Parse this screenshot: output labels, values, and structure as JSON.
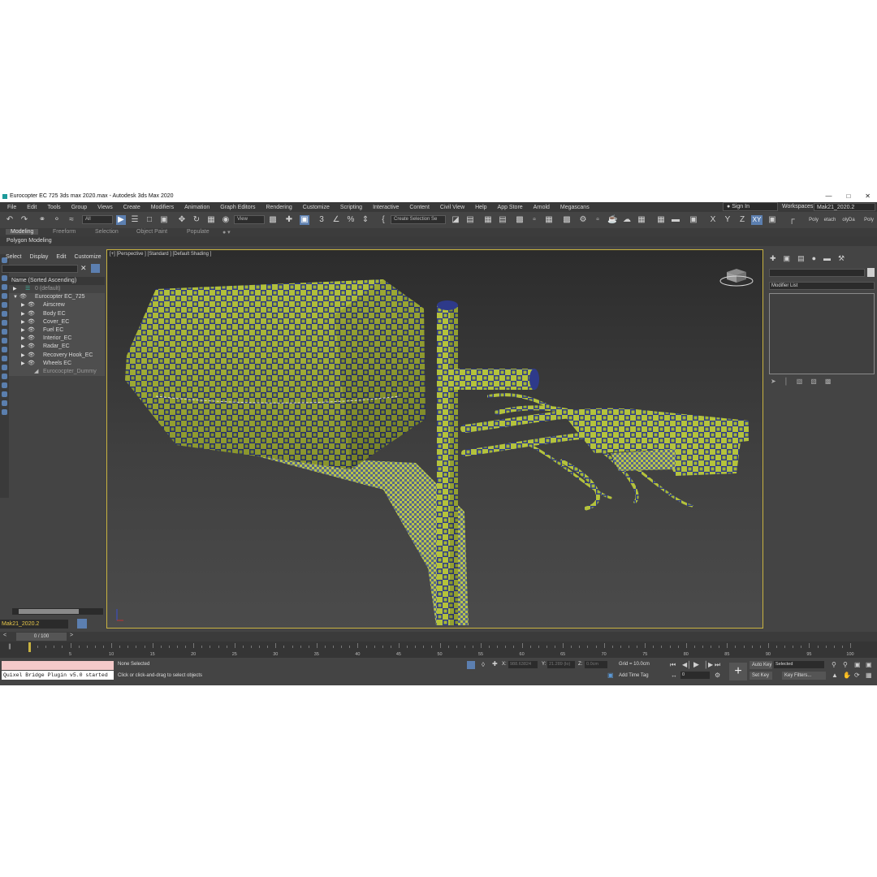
{
  "window": {
    "title": "Eurocopter EC 725 3ds max 2020.max - Autodesk 3ds Max 2020",
    "minimize": "—",
    "maximize": "□",
    "close": "✕"
  },
  "menu": [
    "File",
    "Edit",
    "Tools",
    "Group",
    "Views",
    "Create",
    "Modifiers",
    "Animation",
    "Graph Editors",
    "Rendering",
    "Customize",
    "Scripting",
    "Interactive",
    "Content",
    "Civil View",
    "Help",
    "App Store",
    "Arnold",
    "Megascans"
  ],
  "account": {
    "signin": "Sign In",
    "workspaces_label": "Workspaces:",
    "workspace": "Mak21_2020.2"
  },
  "toolbar": {
    "filter": "All",
    "refcoord": "View",
    "selection_set": "Create Selection Se",
    "axes": [
      "X",
      "Y",
      "Z",
      "XY"
    ],
    "right_labels": [
      "Poly",
      "etach",
      "olyDa",
      "Poly"
    ]
  },
  "ribbon": {
    "tabs": [
      "Modeling",
      "Freeform",
      "Selection",
      "Object Paint",
      "Populate"
    ],
    "sub": "Polygon Modeling"
  },
  "scene_explorer": {
    "tabs": [
      "Select",
      "Display",
      "Edit",
      "Customize"
    ],
    "close": "✕",
    "header": "Name (Sorted Ascending)",
    "items": [
      {
        "label": "0 (default)"
      },
      {
        "label": "Eurocopter EC_725"
      },
      {
        "label": "Airscrew"
      },
      {
        "label": "Body EC"
      },
      {
        "label": "Cover_EC"
      },
      {
        "label": "Fuel EC"
      },
      {
        "label": "Interior_EC"
      },
      {
        "label": "Radar_EC"
      },
      {
        "label": "Recovery Hook_EC"
      },
      {
        "label": "Wheels EC"
      },
      {
        "label": "Eurococpter_Dummy"
      }
    ],
    "layer": "Mak21_2020.2"
  },
  "viewport": {
    "label": "[+] [Perspective ] [Standard ] [Default Shading ]"
  },
  "command_panel": {
    "modifier_list": "Modifier List"
  },
  "timeline": {
    "frame": "0 / 100",
    "prev": "<",
    "next": ">",
    "ticks": [
      "5",
      "10",
      "15",
      "20",
      "25",
      "30",
      "35",
      "40",
      "45",
      "50",
      "55",
      "60",
      "65",
      "70",
      "75",
      "80",
      "85",
      "90",
      "95",
      "100"
    ]
  },
  "status": {
    "script_output": "Quixel Bridge Plugin v5.0 started",
    "selection": "None Selected",
    "prompt": "Click or click-and-drag to select objects",
    "x_label": "X:",
    "x_value": "988.63824",
    "y_label": "Y:",
    "y_value": "21.289 (lo)",
    "z_label": "Z:",
    "z_value": "0.0cm",
    "grid": "Grid = 10.0cm",
    "add_time_tag": "Add Time Tag",
    "auto_key": "Auto Key",
    "set_key": "Set Key",
    "key_mode": "Selected",
    "key_filters": "Key Filters...",
    "frame_field": "0"
  },
  "colors": {
    "accent": "#5c7fb0",
    "viewport_border": "#c9b341",
    "checker_yellow": "#b4c23c",
    "checker_blue": "#2e3a8a"
  }
}
